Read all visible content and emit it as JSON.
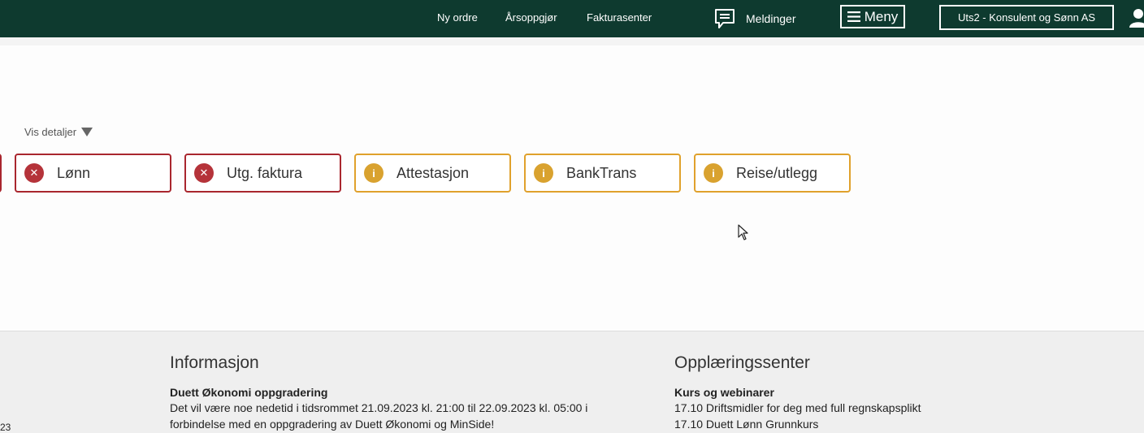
{
  "topnav": {
    "links": [
      "Ny ordre",
      "Årsoppgjør",
      "Fakturasenter"
    ],
    "messages_label": "Meldinger",
    "menu_label": "Meny",
    "company_label": "Uts2 - Konsulent og Sønn AS"
  },
  "details_toggle": "Vis detaljer",
  "status_cards": [
    {
      "label": "Lønn",
      "status": "error",
      "icon": "x-circle-icon"
    },
    {
      "label": "Utg. faktura",
      "status": "error",
      "icon": "x-circle-icon"
    },
    {
      "label": "Attestasjon",
      "status": "warning",
      "icon": "info-circle-icon"
    },
    {
      "label": "BankTrans",
      "status": "warning",
      "icon": "info-circle-icon"
    },
    {
      "label": "Reise/utlegg",
      "status": "warning",
      "icon": "info-circle-icon"
    }
  ],
  "footer": {
    "info": {
      "heading": "Informasjon",
      "subheading": "Duett Økonomi oppgradering",
      "lines": [
        "Det vil være noe nedetid i tidsrommet 21.09.2023 kl. 21:00 til 22.09.2023 kl. 05:00 i",
        "forbindelse med en oppgradering av Duett Økonomi og MinSide!"
      ]
    },
    "training": {
      "heading": "Opplæringssenter",
      "subheading": "Kurs og webinarer",
      "lines": [
        "17.10 Driftsmidler for deg med full regnskapsplikt",
        "17.10 Duett Lønn Grunnkurs"
      ]
    },
    "corner_text": "23"
  },
  "colors": {
    "topbar": "#0e3a2f",
    "error": "#a9262e",
    "warning": "#e0a12c"
  }
}
